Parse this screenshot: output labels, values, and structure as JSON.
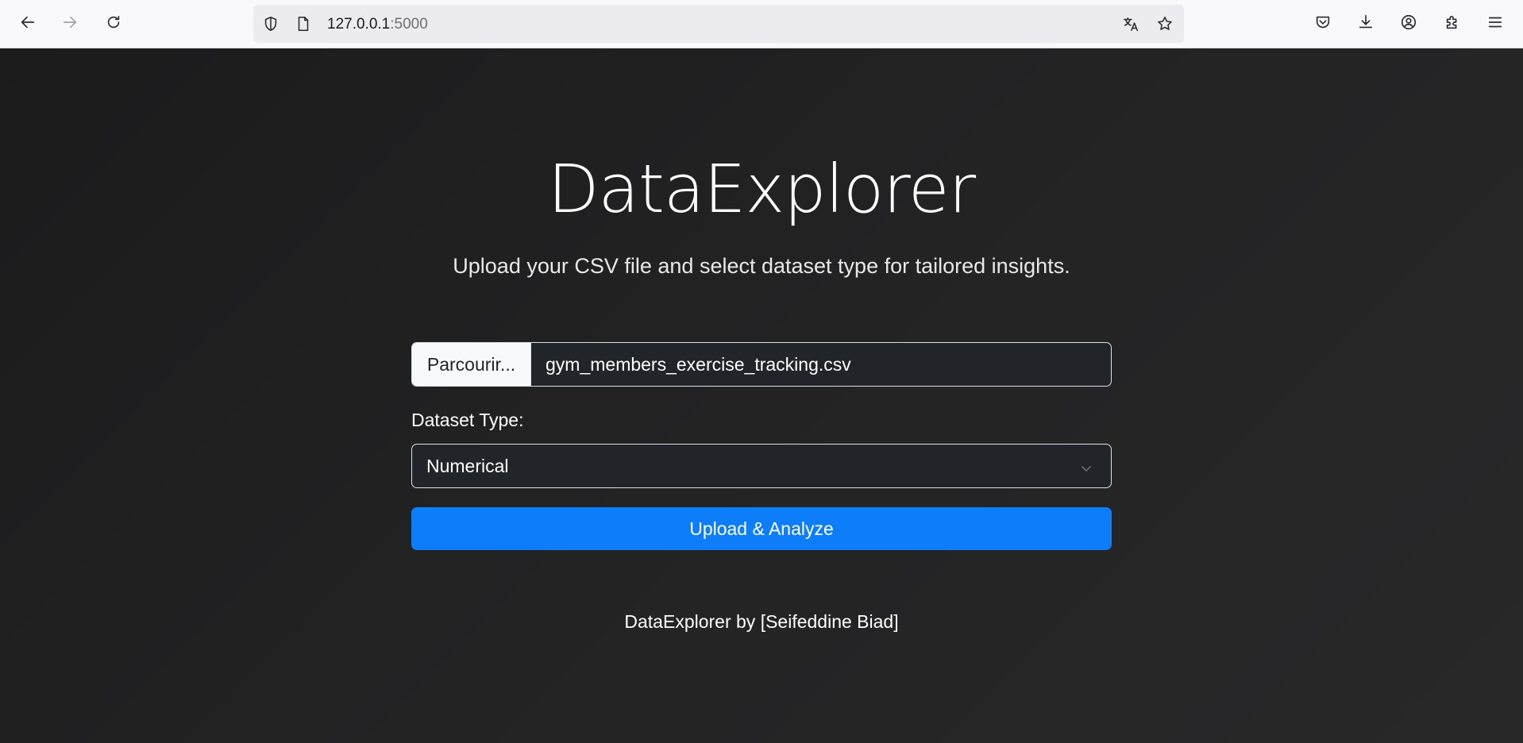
{
  "browser": {
    "url_host": "127.0.0.1",
    "url_port": ":5000",
    "icons": {
      "back": "arrow-left-icon",
      "forward": "arrow-right-icon",
      "reload": "reload-icon",
      "shield": "shield-icon",
      "page": "page-icon",
      "translate": "translate-icon",
      "bookmark": "star-icon",
      "pocket": "pocket-icon",
      "downloads": "download-icon",
      "account": "account-icon",
      "extensions": "extensions-icon",
      "menu": "hamburger-menu-icon"
    }
  },
  "page": {
    "title": "DataExplorer",
    "subtitle": "Upload your CSV file and select dataset type for tailored insights.",
    "file_input": {
      "browse_label": "Parcourir...",
      "file_name": "gym_members_exercise_tracking.csv"
    },
    "dataset_type_label": "Dataset Type:",
    "dataset_type_value": "Numerical",
    "submit_label": "Upload & Analyze",
    "footer": "DataExplorer by [Seifeddine Biad]"
  },
  "colors": {
    "accent": "#0d7df9",
    "background": "#232324",
    "toolbar": "#f9f9fb"
  }
}
